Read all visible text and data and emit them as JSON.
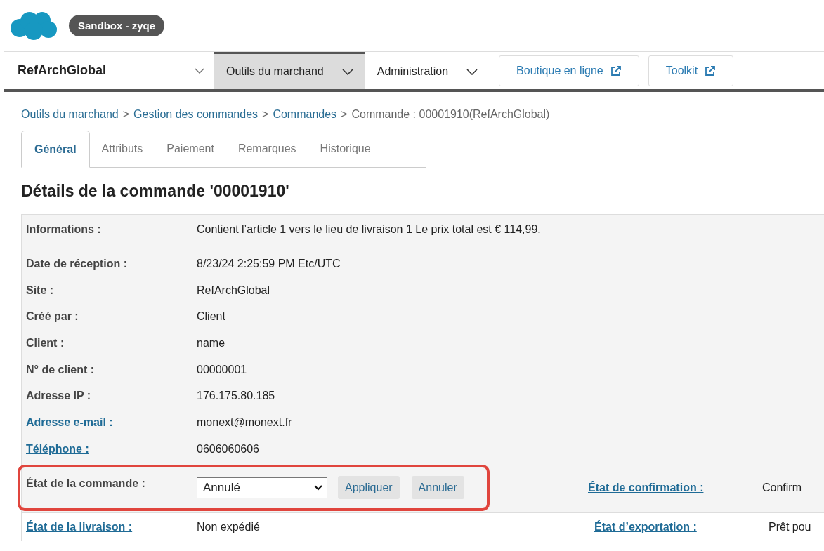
{
  "header": {
    "badge": "Sandbox - zyqe"
  },
  "nav": {
    "site": "RefArchGlobal",
    "menus": [
      {
        "label": "Outils du marchand",
        "selected": true
      },
      {
        "label": "Administration",
        "selected": false
      }
    ],
    "buttons": [
      "Boutique en ligne",
      "Toolkit"
    ]
  },
  "breadcrumb": {
    "separator": ">",
    "links": [
      "Outils du marchand",
      "Gestion des commandes",
      "Commandes"
    ],
    "current": "Commande : 00001910(RefArchGlobal)"
  },
  "tabs": [
    {
      "label": "Général",
      "selected": true
    },
    {
      "label": "Attributs",
      "selected": false
    },
    {
      "label": "Paiement",
      "selected": false
    },
    {
      "label": "Remarques",
      "selected": false
    },
    {
      "label": "Historique",
      "selected": false
    }
  ],
  "heading": "Détails de la commande '00001910'",
  "details": [
    {
      "label": "Informations :",
      "value": "Contient l’article 1 vers le lieu de livraison 1 Le prix total est € 114,99.",
      "link": false
    },
    {
      "label": "Date de réception :",
      "value": "8/23/24 2:25:59 PM Etc/UTC",
      "link": false
    },
    {
      "label": "Site :",
      "value": "RefArchGlobal",
      "link": false
    },
    {
      "label": "Créé par :",
      "value": "Client",
      "link": false
    },
    {
      "label": "Client :",
      "value": "name",
      "link": false
    },
    {
      "label": "N° de client :",
      "value": "00000001",
      "link": false
    },
    {
      "label": "Adresse IP :",
      "value": "176.175.80.185",
      "link": false
    },
    {
      "label": "Adresse e-mail :",
      "value": "monext@monext.fr",
      "link": true
    },
    {
      "label": "Téléphone :",
      "value": "0606060606",
      "link": true
    }
  ],
  "status_row": {
    "label": "État de la commande :",
    "select": "Annulé",
    "buttons": [
      "Appliquer",
      "Annuler"
    ],
    "right_label": "État de confirmation :",
    "right_value": "Confirm"
  },
  "delivery_row": {
    "label": "État de la livraison :",
    "value": "Non expédié",
    "right_label": "État d’exportation :",
    "right_value": "Prêt pou"
  }
}
